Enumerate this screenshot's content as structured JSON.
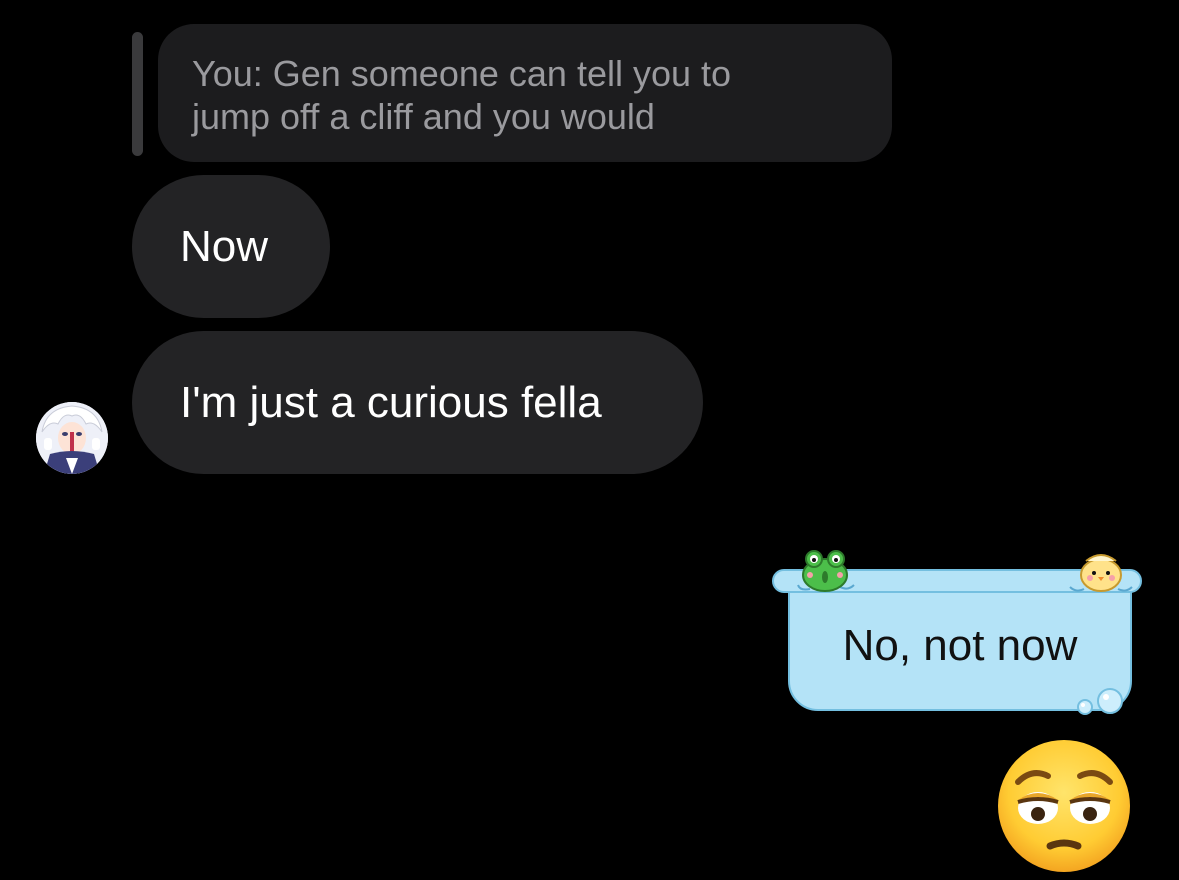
{
  "conversation": {
    "reply_quote": {
      "line1": "You: Gen someone can tell you to",
      "line2": "jump off a cliff and you would"
    },
    "messages": [
      {
        "text": "Now",
        "sender": "other"
      },
      {
        "text": "I'm just a curious fella",
        "sender": "other"
      },
      {
        "text": "No, not now",
        "sender": "me",
        "theme": "bathtub-bubble"
      }
    ],
    "reaction_emoji": "relieved-pensive-face-emoji",
    "avatar": "contact-avatar-anime-character"
  },
  "colors": {
    "background": "#000000",
    "incoming_bubble": "#232325",
    "reply_bubble": "#1c1c1e",
    "reply_text": "#9a9a9e",
    "sent_bubble": "#b4e3f7",
    "sent_border": "#74bfe0"
  }
}
